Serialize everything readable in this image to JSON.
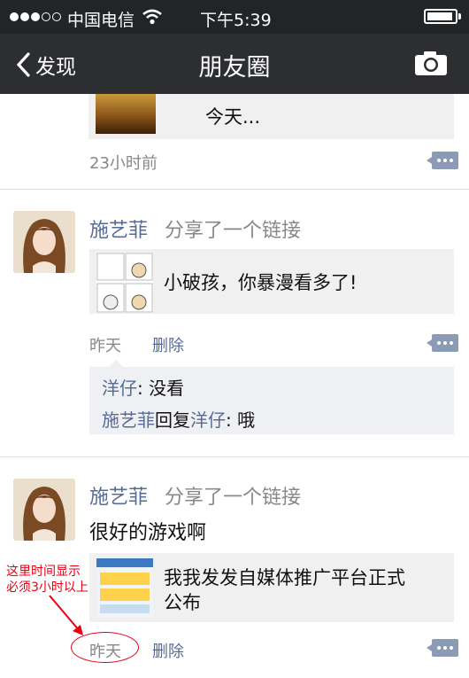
{
  "status": {
    "carrier": "中国电信",
    "time": "下午5:39"
  },
  "nav": {
    "back": "发现",
    "title": "朋友圈"
  },
  "posts": [
    {
      "link_title_line1": "今天...",
      "time": "23小时前"
    },
    {
      "name": "施艺菲",
      "action": "分享了一个链接",
      "link_title": "小破孩，你暴漫看多了!",
      "time": "昨天",
      "delete": "删除",
      "comments": [
        {
          "from": "洋仔",
          "sep": ": ",
          "text": "没看"
        },
        {
          "from": "施艺菲",
          "reply": "回复",
          "to": "洋仔",
          "sep": ": ",
          "text": "哦"
        }
      ]
    },
    {
      "name": "施艺菲",
      "action": "分享了一个链接",
      "text": "很好的游戏啊",
      "link_title_line1": "我我发发自媒体推广平台正式",
      "link_title_line2": "公布",
      "time": "昨天",
      "delete": "删除"
    }
  ],
  "annotation": {
    "line1": "这里时间显示",
    "line2": "必须3小时以上"
  },
  "colors": {
    "name_link": "#576b95",
    "annotation": "#e60012",
    "navbar": "#2c2e31"
  }
}
